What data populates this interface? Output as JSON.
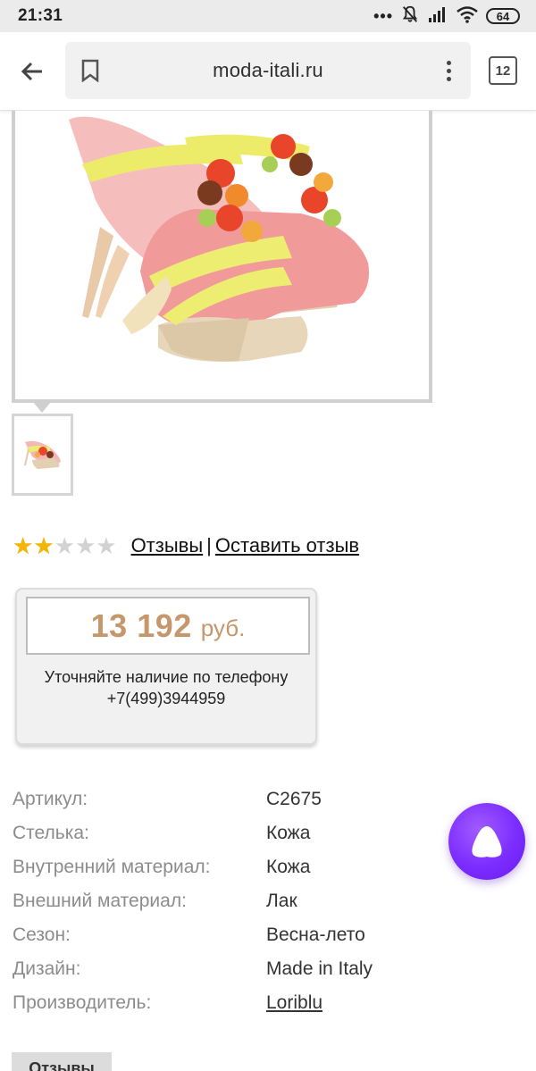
{
  "status_bar": {
    "time": "21:31",
    "dots": "•••",
    "battery": "64",
    "icons": [
      "bell-muted-icon",
      "signal-icon",
      "wifi-icon",
      "battery-icon"
    ]
  },
  "toolbar": {
    "url": "moda-itali.ru",
    "tab_count": "12",
    "icons": [
      "back-arrow-icon",
      "bookmark-icon",
      "kebab-menu-icon",
      "tabs-icon"
    ]
  },
  "product": {
    "rating": {
      "value": 2,
      "max": 5,
      "colors": {
        "on": "#f2b705",
        "off": "#d2d2d2"
      }
    },
    "reviews_link": "Отзывы",
    "separator": "|",
    "leave_review_link": "Оставить отзыв",
    "price": {
      "value": "13 192",
      "currency": "руб.",
      "note": "Уточняйте наличие по телефону +7(499)3944959",
      "color": "#c5976a"
    },
    "specs": [
      {
        "label": "Артикул:",
        "value": "C2675"
      },
      {
        "label": "Стелька:",
        "value": "Кожа"
      },
      {
        "label": "Внутренний материал:",
        "value": "Кожа"
      },
      {
        "label": "Внешний материал:",
        "value": "Лак"
      },
      {
        "label": "Сезон:",
        "value": "Весна-лето"
      },
      {
        "label": "Дизайн:",
        "value": "Made in Italy"
      },
      {
        "label": "Производитель:",
        "value": "Loriblu"
      }
    ]
  },
  "tabs": {
    "reviews_label": "Отзывы"
  },
  "assistant_button": {
    "icon": "alice-assistant-icon",
    "color": "#7b2cff"
  }
}
